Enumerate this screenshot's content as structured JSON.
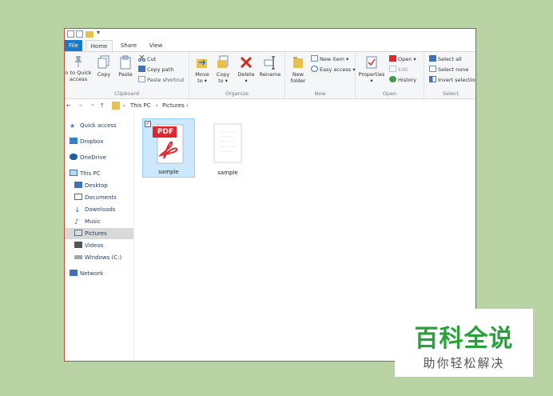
{
  "ribbon_tabs": {
    "file": "File",
    "home": "Home",
    "share": "Share",
    "view": "View"
  },
  "clipboard": {
    "pin_line1": "n to Quick",
    "pin_line2": "access",
    "copy": "Copy",
    "paste": "Paste",
    "cut": "Cut",
    "copy_path": "Copy path",
    "paste_shortcut": "Paste shortcut",
    "label": "Clipboard"
  },
  "organize": {
    "move_to": "Move",
    "move_to2": "to ▾",
    "copy_to": "Copy",
    "copy_to2": "to ▾",
    "delete": "Delete",
    "delete2": "▾",
    "rename": "Rename",
    "label": "Organize"
  },
  "new": {
    "new_folder1": "New",
    "new_folder2": "folder",
    "new_item": "New item ▾",
    "easy_access": "Easy access ▾",
    "label": "New"
  },
  "open": {
    "properties": "Properties",
    "properties2": "▾",
    "open": "Open ▾",
    "edit": "Edit",
    "history": "History",
    "label": "Open"
  },
  "select": {
    "select_all": "Select all",
    "select_none": "Select none",
    "invert": "Invert selection",
    "label": "Select"
  },
  "address": {
    "back": "←",
    "forward": "→",
    "recent": "⌄",
    "up": "↑",
    "sep1": "›",
    "this_pc": "This PC",
    "sep2": "›",
    "pictures": "Pictures",
    "sep3": "›"
  },
  "nav": {
    "quick_access": "Quick access",
    "dropbox": "Dropbox",
    "onedrive": "OneDrive",
    "this_pc": "This PC",
    "desktop": "Desktop",
    "documents": "Documents",
    "downloads": "Downloads",
    "music": "Music",
    "pictures": "Pictures",
    "videos": "Videos",
    "windows_c": "Windows (C:)",
    "network": "Network"
  },
  "files": [
    {
      "name": "sample",
      "badge": "PDF"
    },
    {
      "name": "sample"
    }
  ],
  "watermark": {
    "title": "百科全说",
    "subtitle": "助你轻松解决"
  },
  "colors": {
    "accent": "#1979ca",
    "pdf_red": "#e1262d",
    "watermark_green": "#27a23b",
    "window_border": "#c14c3f"
  }
}
